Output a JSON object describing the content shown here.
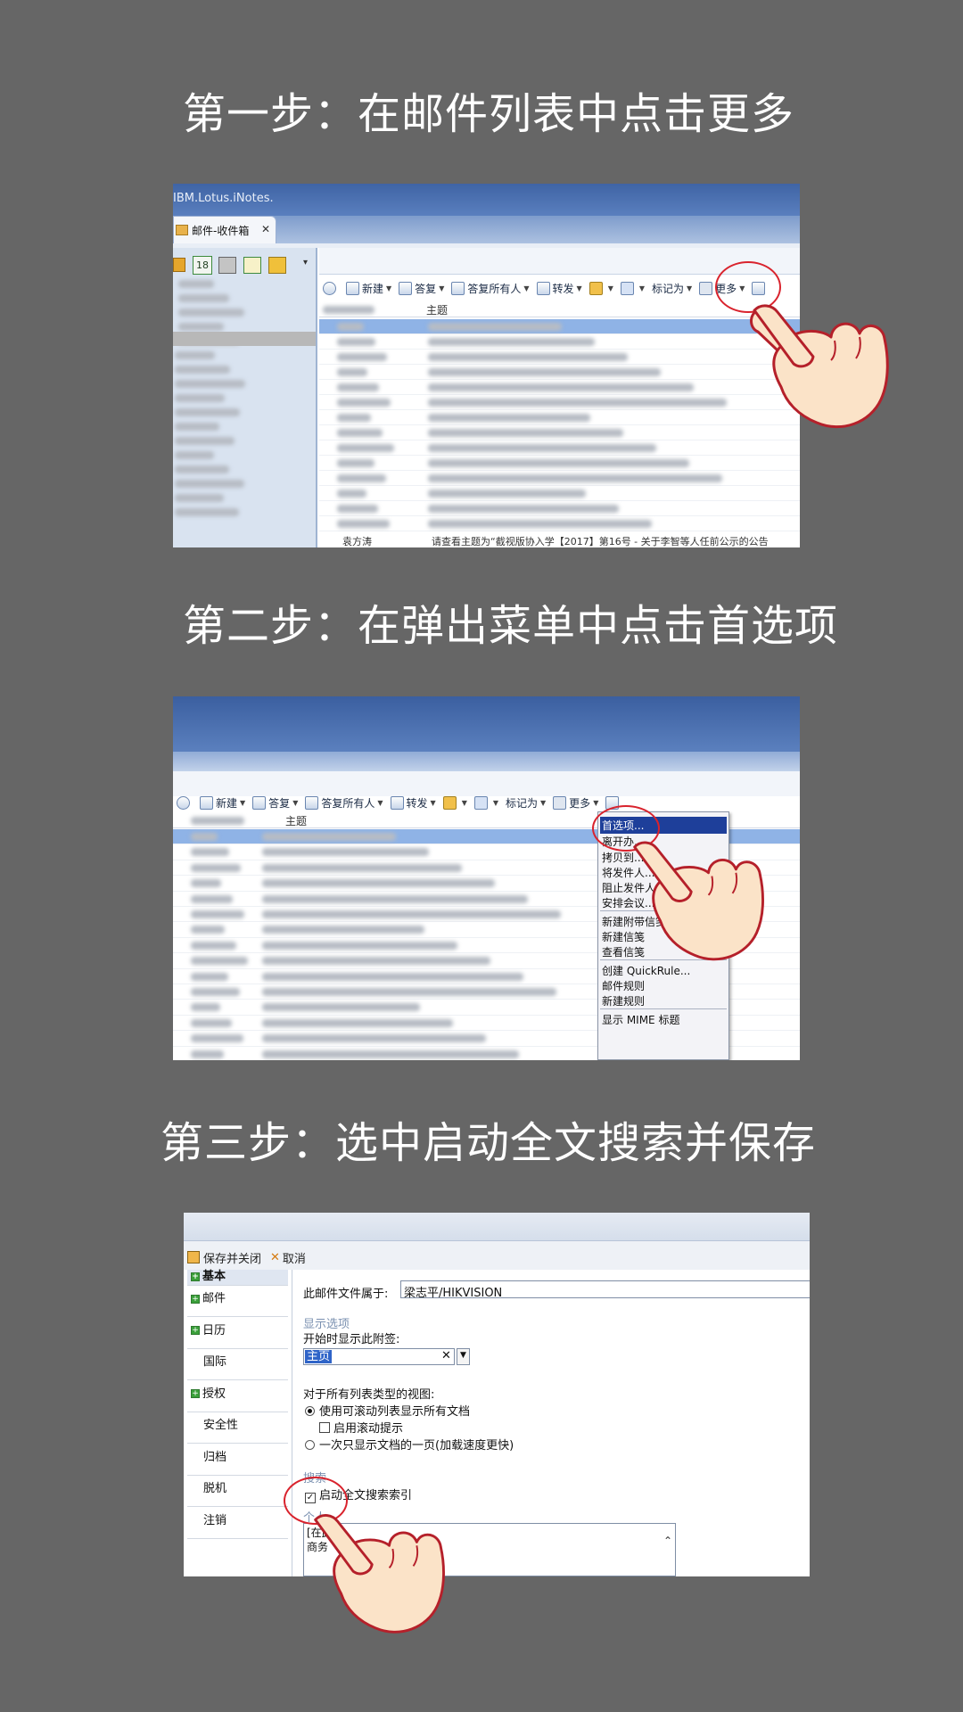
{
  "steps": [
    {
      "title": "第一步：在邮件列表中点击更多"
    },
    {
      "title": "第二步：在弹出菜单中点击首选项"
    },
    {
      "title": "第三步：选中启动全文搜索并保存"
    }
  ],
  "panel1": {
    "app_title": "IBM.Lotus.iNotes.",
    "tab_label": "邮件-收件箱",
    "tab_close": "✕",
    "calendar_day": "18",
    "toolbar": {
      "new": "新建",
      "reply": "答复",
      "reply_all": "答复所有人",
      "forward": "转发",
      "mark_as": "标记为",
      "more": "更多"
    },
    "header_subject": "主题",
    "last_row_sender": "袁方涛",
    "last_row_subject": "请查看主题为“截视版协入学【2017】第16号 - 关于李智等人任前公示的公告"
  },
  "panel2": {
    "toolbar": {
      "new": "新建",
      "reply": "答复",
      "reply_all": "答复所有人",
      "forward": "转发",
      "mark_as": "标记为",
      "more": "更多"
    },
    "header_subject": "主题",
    "menu_items": [
      "首选项...",
      "离开办...",
      "拷贝到...",
      "将发件人...",
      "阻止发件人...",
      "安排会议...",
      "新建附带信笺的...",
      "新建信笺",
      "查看信笺",
      "创建 QuickRule...",
      "邮件规则",
      "新建规则",
      "显示 MIME 标题"
    ]
  },
  "panel3": {
    "toolbar": {
      "save_close": "保存并关闭",
      "cancel": "取消"
    },
    "nav": [
      {
        "label": "基本",
        "expand": true
      },
      {
        "label": "邮件",
        "expand": true
      },
      {
        "label": "日历",
        "expand": true
      },
      {
        "label": "国际",
        "expand": false
      },
      {
        "label": "授权",
        "expand": true
      },
      {
        "label": "安全性",
        "expand": false
      },
      {
        "label": "归档",
        "expand": false
      },
      {
        "label": "脱机",
        "expand": false
      },
      {
        "label": "注销",
        "expand": false
      }
    ],
    "owner_label": "此邮件文件属于:",
    "owner_value": "梁志平/HIKVISION",
    "display_section": "显示选项",
    "start_tab_label": "开始时显示此附签:",
    "start_tab_value": "主页",
    "views_label": "对于所有列表类型的视图:",
    "radio_scroll": "使用可滚动列表显示所有文档",
    "check_scroll_tip": "启用滚动提示",
    "radio_page": "一次只显示文档的一页(加载速度更快)",
    "search_section": "搜索",
    "fulltext_label": "启动全文搜索索引",
    "personal_section": "个人",
    "list_item_1": "[在此处",
    "list_item_2": "商务"
  },
  "colors": {
    "background": "#666666",
    "highlight_ring": "#d9232d",
    "selection_blue": "#2b4ea3"
  }
}
